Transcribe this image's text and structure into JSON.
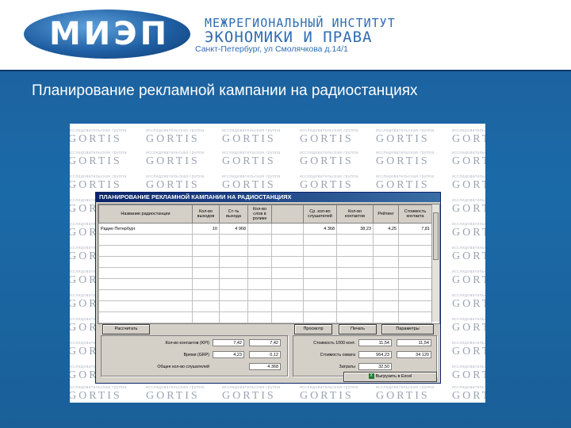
{
  "header": {
    "logo_text": "МИЭП",
    "institute_line1": "МЕЖРЕГИОНАЛЬНЫЙ ИНСТИТУТ",
    "institute_line2": "ЭКОНОМИКИ И ПРАВА",
    "address": "Санкт-Петербург, ул Смолячкова д.14/1"
  },
  "slide": {
    "title": "Планирование рекламной кампании на радиостанциях"
  },
  "watermark": {
    "brand": "GORTIS",
    "tagline": "исследовательская группа"
  },
  "app": {
    "window_title": "ПЛАНИРОВАНИЕ РЕКЛАМНОЙ КАМПАНИИ НА РАДИОСТАНЦИЯХ",
    "columns": [
      "Название радиостанции",
      "Кол-во выходов",
      "Ст-ть выхода",
      "Кол-во слов в ролике",
      "",
      "Ср. кол-во слушателей",
      "Кол-во контактов",
      "Рейтинг",
      "Стоимость контакта"
    ],
    "rows": [
      {
        "name": "Радио Петербург",
        "outputs": "10",
        "price": "4 968",
        "words": "",
        "blank": "",
        "listeners": "4 368",
        "contacts": "38,23",
        "rating": "4,25",
        "cost": "7,81"
      }
    ],
    "buttons": {
      "calculate": "Рассчитать",
      "preview": "Просмотр",
      "print": "Печать",
      "setup": "Параметры",
      "export": "Выгрузить в Excel"
    },
    "left_panel": [
      {
        "label": "Кол-во контактов (KPI)",
        "value": "7,42",
        "value2": "7,42"
      },
      {
        "label": "Время (GRP)",
        "value": "4,23",
        "value2": "0,12"
      },
      {
        "label": "Общее кол-во слушателей",
        "value": "4 368",
        "value2": ""
      }
    ],
    "right_panel": [
      {
        "label": "Стоимость 1000 конт.",
        "value": "11,54",
        "value2": "11,54"
      },
      {
        "label": "Стоимость охвата",
        "value": "964,23",
        "value2": "34 120"
      },
      {
        "label": "Затраты",
        "value": "32,50",
        "value2": ""
      }
    ]
  }
}
